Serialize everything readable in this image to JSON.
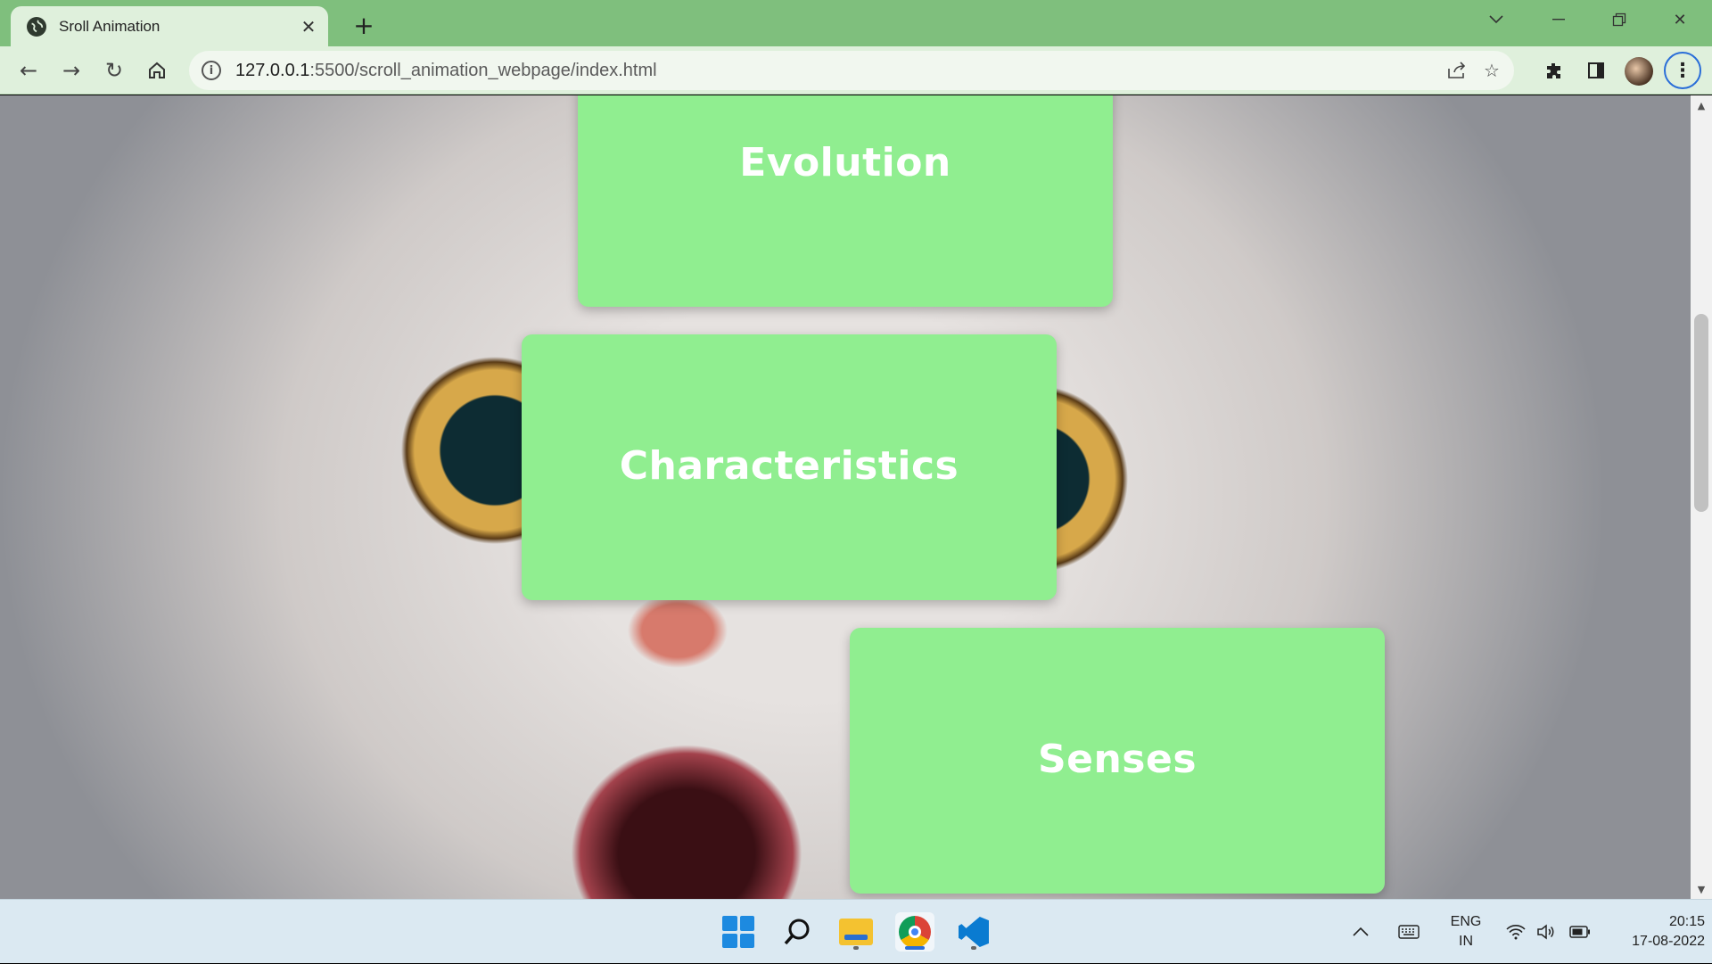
{
  "browser": {
    "tab": {
      "title": "Sroll Animation"
    },
    "address": {
      "host": "127.0.0.1",
      "rest": ":5500/scroll_animation_webpage/index.html"
    }
  },
  "page": {
    "cards": [
      {
        "title": "Evolution"
      },
      {
        "title": "Characteristics"
      },
      {
        "title": "Senses"
      }
    ],
    "card_color": "#90ee90"
  },
  "taskbar": {
    "language": {
      "line1": "ENG",
      "line2": "IN"
    },
    "clock": {
      "time": "20:15",
      "date": "17-08-2022"
    }
  },
  "icons": [
    "globe-icon",
    "close-icon",
    "plus-icon",
    "chevron-down-icon",
    "minimize-icon",
    "restore-icon",
    "back-icon",
    "forward-icon",
    "reload-icon",
    "home-icon",
    "info-icon",
    "share-icon",
    "star-icon",
    "extensions-icon",
    "sidepanel-icon",
    "more-icon",
    "windows-start-icon",
    "search-icon",
    "file-explorer-icon",
    "chrome-icon",
    "vscode-icon",
    "chevron-up-icon",
    "keyboard-icon",
    "wifi-icon",
    "volume-icon",
    "battery-icon"
  ]
}
